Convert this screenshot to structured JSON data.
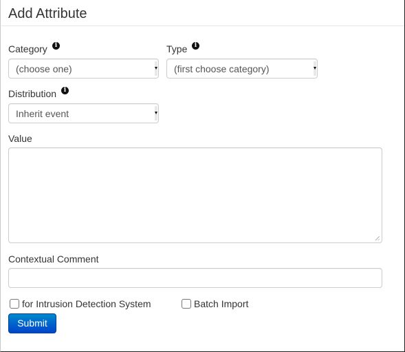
{
  "form": {
    "title": "Add Attribute",
    "category": {
      "label": "Category",
      "selected": "(choose one)",
      "info_icon": "info-circle-icon"
    },
    "type": {
      "label": "Type",
      "selected": "(first choose category)",
      "info_icon": "info-circle-icon"
    },
    "distribution": {
      "label": "Distribution",
      "selected": "Inherit event",
      "info_icon": "info-circle-icon"
    },
    "value": {
      "label": "Value",
      "text": ""
    },
    "comment": {
      "label": "Contextual Comment",
      "text": ""
    },
    "ids_checkbox": {
      "label": "for Intrusion Detection System",
      "checked": false
    },
    "batch_checkbox": {
      "label": "Batch Import",
      "checked": false
    },
    "submit_label": "Submit"
  },
  "colors": {
    "primary_button": "#0055cc",
    "text": "#333333",
    "border": "#cccccc"
  }
}
